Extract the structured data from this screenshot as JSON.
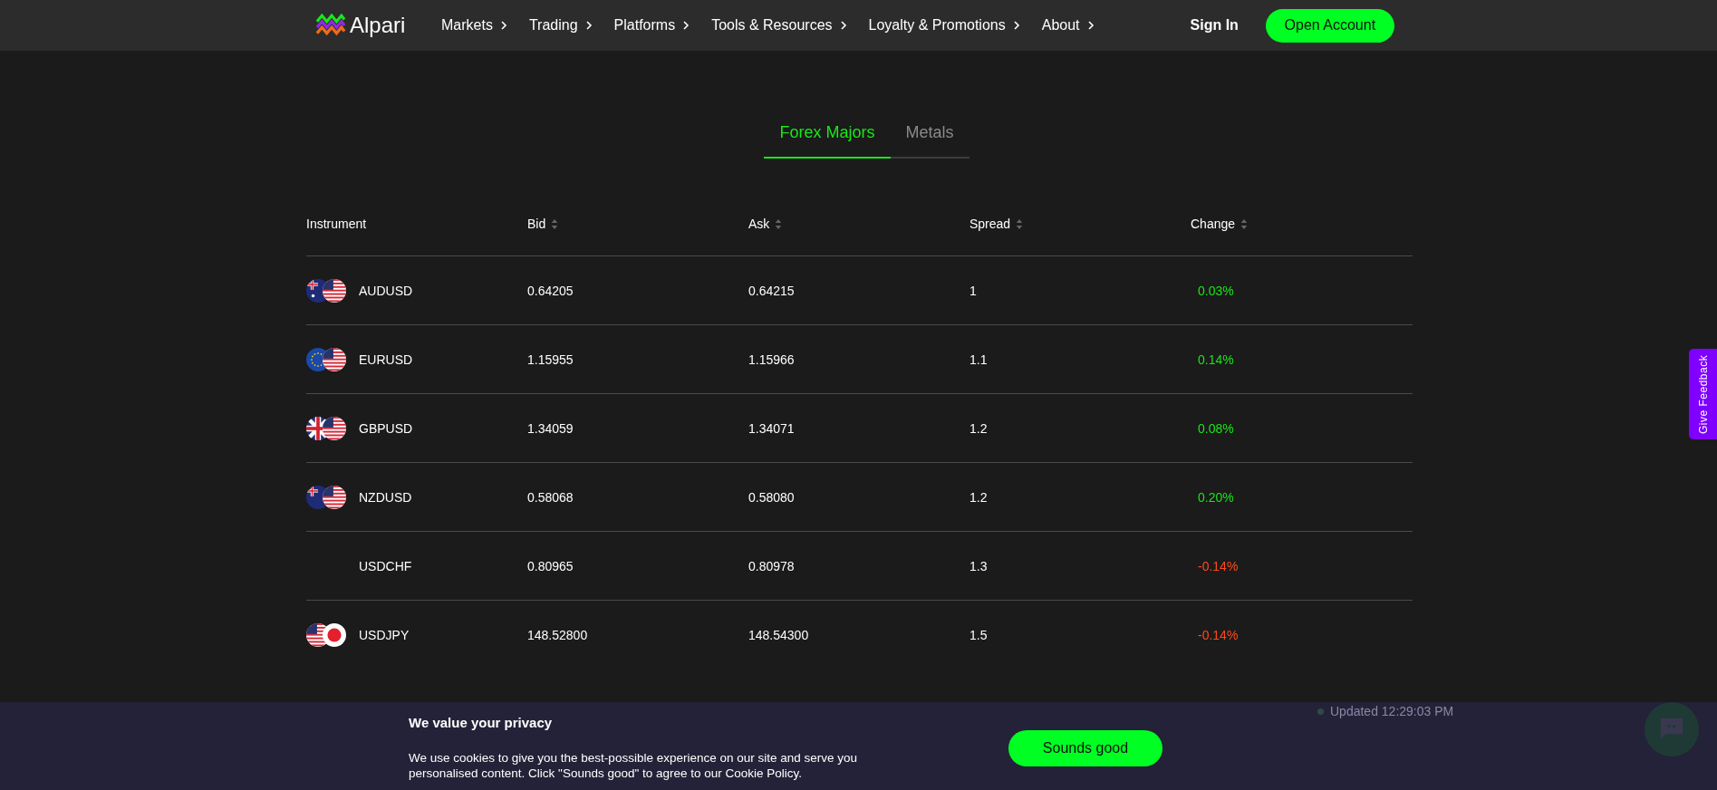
{
  "header": {
    "logo_text": "Alpari",
    "nav": [
      "Markets",
      "Trading",
      "Platforms",
      "Tools & Resources",
      "Loyalty & Promotions",
      "About"
    ],
    "sign_in": "Sign In",
    "open_account": "Open Account"
  },
  "tabs": [
    {
      "label": "Forex Majors",
      "selected": true
    },
    {
      "label": "Metals",
      "selected": false
    }
  ],
  "table": {
    "columns": [
      "Instrument",
      "Bid",
      "Ask",
      "Spread",
      "Change"
    ],
    "rows": [
      {
        "instrument": "AUDUSD",
        "bid": "0.64205",
        "ask": "0.64215",
        "spread": "1",
        "change": "0.03%",
        "color": "#19e619"
      },
      {
        "instrument": "EURUSD",
        "bid": "1.15955",
        "ask": "1.15966",
        "spread": "1.1",
        "change": "0.14%",
        "color": "#19e619"
      },
      {
        "instrument": "GBPUSD",
        "bid": "1.34059",
        "ask": "1.34071",
        "spread": "1.2",
        "change": "0.08%",
        "color": "#19e619"
      },
      {
        "instrument": "NZDUSD",
        "bid": "0.58068",
        "ask": "0.58080",
        "spread": "1.2",
        "change": "0.20%",
        "color": "#19e619"
      },
      {
        "instrument": "USDCHF",
        "bid": "0.80965",
        "ask": "0.80978",
        "spread": "1.3",
        "change": "-0.14%",
        "color": "#ff4a1c"
      },
      {
        "instrument": "USDJPY",
        "bid": "148.52800",
        "ask": "148.54300",
        "spread": "1.5",
        "change": "-0.14%",
        "color": "#ff4a1c"
      }
    ]
  },
  "updated": "Updated 12:29:03 PM",
  "feedback_tab": "Give Feedback",
  "cookie_banner": {
    "title": "We value your privacy",
    "text": "We use cookies to give you the best-possible experience on our site and serve you personalised content. Click \"Sounds good\" to agree to our Cookie Policy.",
    "button": "Sounds good"
  }
}
